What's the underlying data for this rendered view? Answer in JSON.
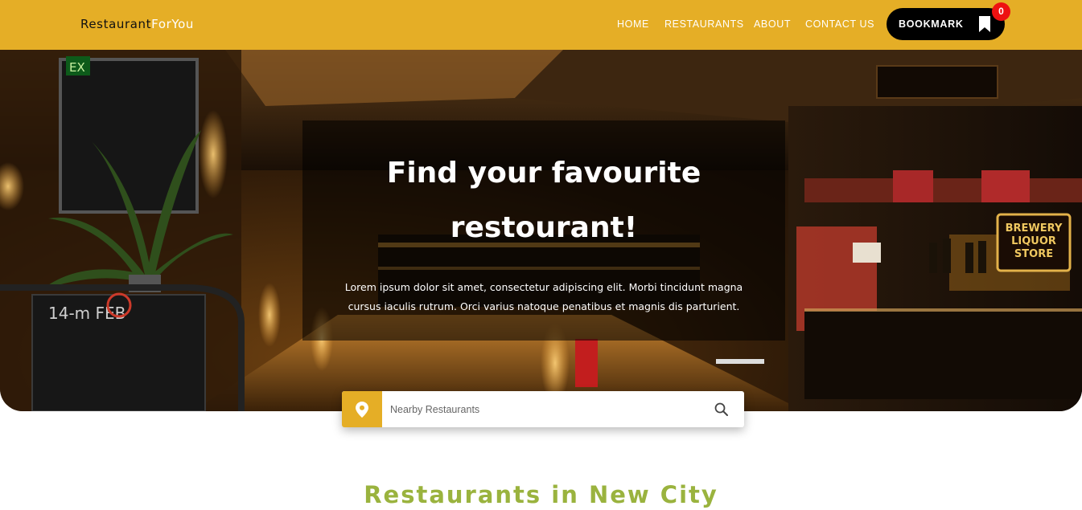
{
  "brand": {
    "name_part1": "Restaurant",
    "name_part2": "ForYou",
    "color": "#e5ae26"
  },
  "nav": {
    "links": [
      {
        "label": "HOME"
      },
      {
        "label": "RESTAURANTS"
      },
      {
        "label": "ABOUT"
      },
      {
        "label": "CONTACT US"
      }
    ],
    "bookmark": {
      "label": "BOOKMARK",
      "icon": "bookmark-icon",
      "count": "0"
    }
  },
  "hero": {
    "title_line1": "Find your favourite",
    "title_line2": "restourant!",
    "text_line1": "Lorem ipsum dolor sit amet, consectetur adipiscing elit. Morbi tincidunt magna",
    "text_line2": "cursus iaculis rutrum. Orci varius natoque penatibus et magnis dis parturient.",
    "sign_line1": "BREWERY",
    "sign_line2": "LIQUOR",
    "sign_line3": "STORE",
    "exit_sign": "EX",
    "board_text": "14-m FEB"
  },
  "search": {
    "placeholder": "Nearby Restaurants",
    "location_icon": "map-pin-icon",
    "search_icon": "search-icon"
  },
  "section": {
    "title": "Restaurants in New City",
    "title_color": "#9ab33e"
  }
}
